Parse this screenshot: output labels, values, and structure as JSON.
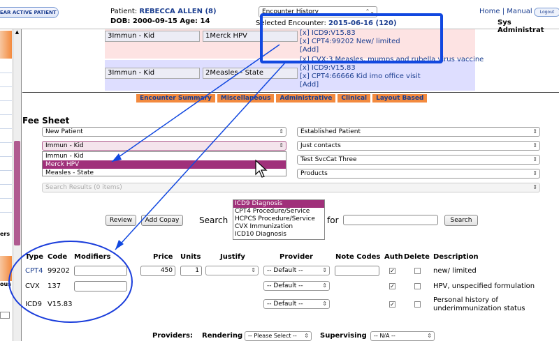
{
  "topbar": {
    "clear_label": "LEAR ACTIVE PATIENT",
    "patient_label": "Patient:",
    "patient_name": "REBECCA ALLEN (8)",
    "dob_age": "DOB: 2000-09-15 Age: 14",
    "encounter_history": "Encounter History",
    "selected_encounter_label": "Selected Encounter:",
    "selected_encounter_value": "2015-06-16 (120)",
    "home": "Home",
    "sep": "|",
    "manual": "Manual",
    "logout": "Logout",
    "user": "Sys Administrat"
  },
  "encounter_rows": [
    {
      "category": "3Immun - Kid",
      "item": "1Merck HPV",
      "codes": [
        "[x] ICD9:V15.83",
        "[x] CPT4:99202 New/ limited"
      ],
      "add": "[Add]"
    },
    {
      "category": "3Immun - Kid",
      "item": "2Measles - State",
      "codes": [
        "[x] CVX:3 Measles, mumps and rubella virus vaccine",
        "[x] ICD9:V15.83",
        "[x] CPT4:66666 Kid imo office visit"
      ],
      "add": "[Add]"
    }
  ],
  "tabs": [
    "Encounter Summary",
    "Miscellaneous",
    "Administrative",
    "Clinical",
    "Layout Based"
  ],
  "fee_sheet": {
    "title": "Fee Sheet",
    "left_selects": [
      "New Patient",
      "Immun - Kid"
    ],
    "right_selects": [
      "Established Patient",
      "Just contacts",
      "Test SvcCat Three",
      "Products"
    ],
    "dropdown_options": [
      "Immun - Kid",
      "Merck HPV",
      "Measles - State"
    ],
    "dropdown_selected": "Merck HPV",
    "search_results": "Search Results (0 items)"
  },
  "search": {
    "review": "Review",
    "add_copay": "Add Copay",
    "search_label": "Search",
    "for_label": "for",
    "search_button": "Search",
    "code_types": [
      "ICD9 Diagnosis",
      "CPT4 Procedure/Service",
      "HCPCS Procedure/Service",
      "CVX Immunization",
      "ICD10 Diagnosis"
    ],
    "selected_code_type": "ICD9 Diagnosis"
  },
  "table": {
    "headers": [
      "Type",
      "Code",
      "Modifiers",
      "Price",
      "Units",
      "Justify",
      "Provider",
      "Note Codes",
      "Auth",
      "Delete",
      "Description"
    ],
    "rows": [
      {
        "type": "CPT4",
        "code": "99202",
        "price": "450",
        "units": "1",
        "provider": "-- Default --",
        "auth": true,
        "delete": false,
        "description": "new/ limited"
      },
      {
        "type": "CVX",
        "code": "137",
        "provider": "-- Default --",
        "auth": true,
        "delete": false,
        "description": "HPV, unspecified formulation"
      },
      {
        "type": "ICD9",
        "code": "V15.83",
        "provider": "-- Default --",
        "auth": true,
        "delete": false,
        "description": "Personal history of underimmunization status"
      }
    ]
  },
  "providers": {
    "label": "Providers:",
    "rendering_label": "Rendering",
    "rendering_value": "-- Please Select --",
    "supervising_label": "Supervising",
    "supervising_value": "-- N/A --"
  },
  "left_nav": {
    "partial_labels": [
      "ers",
      "ous"
    ]
  },
  "colors": {
    "accent_orange": "#f38a3e",
    "link_blue": "#1a3d8f",
    "highlight_purple": "#a0307a",
    "annotation_blue": "#1148e0"
  }
}
